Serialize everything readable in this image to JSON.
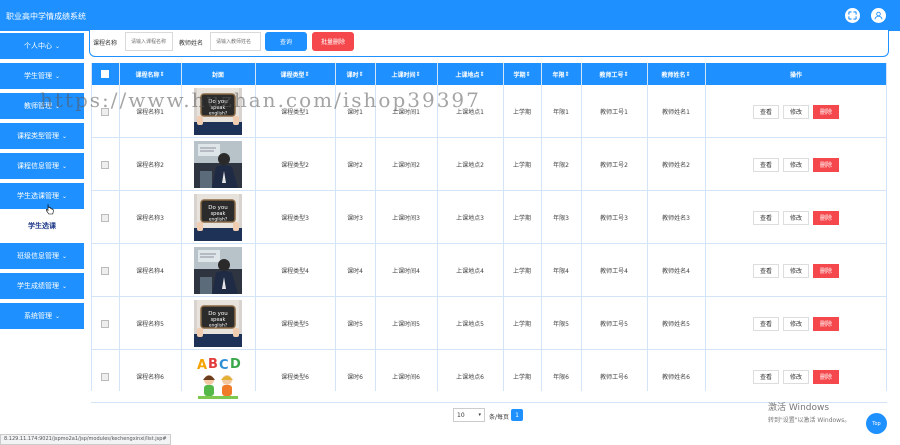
{
  "header": {
    "title": "职业高中学情成绩系统"
  },
  "sidebar": {
    "items": [
      {
        "label": "个人中心",
        "type": "menu"
      },
      {
        "label": "学生管理",
        "type": "menu"
      },
      {
        "label": "教师管理",
        "type": "menu"
      },
      {
        "label": "课程类型管理",
        "type": "menu"
      },
      {
        "label": "课程信息管理",
        "type": "menu"
      },
      {
        "label": "学生选课管理",
        "type": "menu"
      },
      {
        "label": "学生选课",
        "type": "sub"
      },
      {
        "label": "班级信息管理",
        "type": "menu"
      },
      {
        "label": "学生成绩管理",
        "type": "menu"
      },
      {
        "label": "系统管理",
        "type": "menu"
      }
    ]
  },
  "filter": {
    "course_name_label": "课程名称",
    "course_name_placeholder": "请输入课程名称",
    "teacher_name_label": "教师姓名",
    "teacher_name_placeholder": "请输入教师姓名",
    "search_label": "查询",
    "batch_delete_label": "批量删除"
  },
  "table": {
    "headers": [
      "课程名称",
      "封面",
      "课程类型",
      "课时",
      "上课时间",
      "上课地点",
      "学期",
      "年限",
      "教师工号",
      "教师姓名",
      "操作"
    ],
    "rows": [
      {
        "name": "课程名称1",
        "cover": "speak-english",
        "type": "课程类型1",
        "hours": "课时1",
        "time": "上课时间1",
        "place": "上课地点1",
        "term": "上学期",
        "year": "年限1",
        "tno": "教师工号1",
        "tname": "教师姓名1"
      },
      {
        "name": "课程名称2",
        "cover": "classroom",
        "type": "课程类型2",
        "hours": "课时2",
        "time": "上课时间2",
        "place": "上课地点2",
        "term": "上学期",
        "year": "年限2",
        "tno": "教师工号2",
        "tname": "教师姓名2"
      },
      {
        "name": "课程名称3",
        "cover": "speak-english",
        "type": "课程类型3",
        "hours": "课时3",
        "time": "上课时间3",
        "place": "上课地点3",
        "term": "上学期",
        "year": "年限3",
        "tno": "教师工号3",
        "tname": "教师姓名3"
      },
      {
        "name": "课程名称4",
        "cover": "classroom",
        "type": "课程类型4",
        "hours": "课时4",
        "time": "上课时间4",
        "place": "上课地点4",
        "term": "上学期",
        "year": "年限4",
        "tno": "教师工号4",
        "tname": "教师姓名4"
      },
      {
        "name": "课程名称5",
        "cover": "speak-english",
        "type": "课程类型5",
        "hours": "课时5",
        "time": "上课时间5",
        "place": "上课地点5",
        "term": "上学期",
        "year": "年限5",
        "tno": "教师工号5",
        "tname": "教师姓名5"
      },
      {
        "name": "课程名称6",
        "cover": "abcd-kids",
        "type": "课程类型6",
        "hours": "课时6",
        "time": "上课时间6",
        "place": "上课地点6",
        "term": "上学期",
        "year": "年限6",
        "tno": "教师工号6",
        "tname": "教师姓名6"
      }
    ],
    "actions": {
      "view": "查看",
      "edit": "修改",
      "delete": "删除"
    }
  },
  "cover_text": {
    "speak": "Do you speak english?",
    "abcd": "ABCD"
  },
  "pagination": {
    "page_size": "10",
    "per_page_label": "条/每页",
    "current_page": "1"
  },
  "watermark": "https://www.huzhan.com/ishop39397",
  "statusbar": "8.129.11.174:9021/jspmo2a1/jsp/modules/kechengxinxi/list.jsp#",
  "windows_activation": {
    "line1": "激活 Windows",
    "line2": "转到\"设置\"以激活 Windows。"
  },
  "top_button_label": "Top",
  "colors": {
    "primary": "#1e90ff",
    "danger": "#f5484d"
  }
}
